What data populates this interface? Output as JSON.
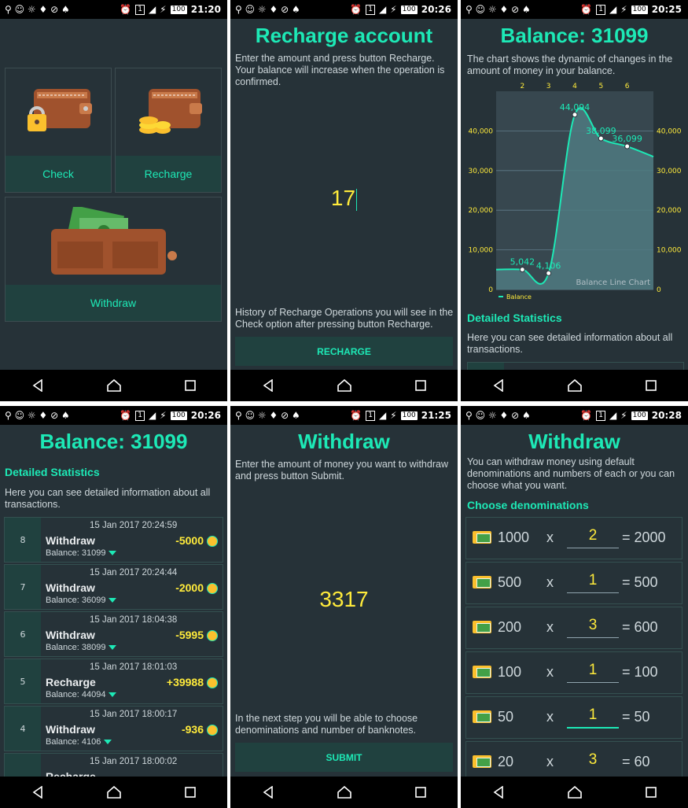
{
  "status": {
    "times": [
      "21:20",
      "20:26",
      "20:25",
      "20:26",
      "21:25",
      "20:28"
    ],
    "sim": "1",
    "battery": "100"
  },
  "home": {
    "check_label": "Check",
    "recharge_label": "Recharge",
    "withdraw_label": "Withdraw"
  },
  "recharge": {
    "title": "Recharge account",
    "instructions": "Enter the amount and press button Recharge. Your balance will increase when the operation is confirmed.",
    "amount_value": "17",
    "history_note": "History of Recharge Operations you will see in the Check option after pressing button Recharge.",
    "button_label": "RECHARGE"
  },
  "balance_chart_screen": {
    "title": "Balance: 31099",
    "description": "The chart shows the dynamic of changes in the amount of money in your balance.",
    "stats_heading": "Detailed Statistics",
    "stats_text": "Here you can see detailed information about all transactions."
  },
  "chart_data": {
    "type": "area",
    "title": "Balance Line Chart",
    "x": [
      1,
      2,
      3,
      4,
      5,
      6,
      7
    ],
    "x_ticks": [
      "2",
      "3",
      "4",
      "5",
      "6"
    ],
    "series": [
      {
        "name": "Balance",
        "values": [
          5042,
          5042,
          4106,
          44094,
          38099,
          36099,
          33500
        ]
      }
    ],
    "data_labels": [
      {
        "x": 2,
        "text": "5,042"
      },
      {
        "x": 3,
        "text": "4,106"
      },
      {
        "x": 4,
        "text": "44,094"
      },
      {
        "x": 5,
        "text": "38,099"
      },
      {
        "x": 6,
        "text": "36,099"
      }
    ],
    "y_ticks": [
      "0",
      "10,000",
      "20,000",
      "30,000",
      "40,000"
    ],
    "ylim": [
      0,
      50000
    ],
    "xlim": [
      1,
      7
    ],
    "grid": true,
    "legend": "bottom-left"
  },
  "stats": {
    "title": "Balance: 31099",
    "heading": "Detailed Statistics",
    "text": "Here you can see detailed information about all transactions.",
    "rows": [
      {
        "num": "8",
        "date": "15 Jan 2017 20:24:59",
        "type": "Withdraw",
        "amount": "-5000",
        "balance": "Balance:  31099"
      },
      {
        "num": "7",
        "date": "15 Jan 2017 20:24:44",
        "type": "Withdraw",
        "amount": "-2000",
        "balance": "Balance:  36099"
      },
      {
        "num": "6",
        "date": "15 Jan 2017 18:04:38",
        "type": "Withdraw",
        "amount": "-5995",
        "balance": "Balance:  38099"
      },
      {
        "num": "5",
        "date": "15 Jan 2017 18:01:03",
        "type": "Recharge",
        "amount": "+39988",
        "balance": "Balance:  44094"
      },
      {
        "num": "4",
        "date": "15 Jan 2017 18:00:17",
        "type": "Withdraw",
        "amount": "-936",
        "balance": "Balance:  4106"
      },
      {
        "num": "",
        "date": "15 Jan 2017 18:00:02",
        "type": "Recharge",
        "amount": "",
        "balance": ""
      }
    ]
  },
  "withdraw": {
    "title": "Withdraw",
    "instructions": "Enter the amount of money you want to withdraw and press button Submit.",
    "amount_value": "3317",
    "note": "In the next step you will be able to choose denominations and number of banknotes.",
    "button_label": "SUBMIT"
  },
  "denominations": {
    "title": "Withdraw",
    "text": "You can withdraw money using default denominations and numbers of each or you can choose what you want.",
    "heading": "Choose denominations",
    "rows": [
      {
        "value": "1000",
        "x": "x",
        "qty": "2",
        "total": "= 2000"
      },
      {
        "value": "500",
        "x": "x",
        "qty": "1",
        "total": "= 500"
      },
      {
        "value": "200",
        "x": "x",
        "qty": "3",
        "total": "= 600"
      },
      {
        "value": "100",
        "x": "x",
        "qty": "1",
        "total": "= 100"
      },
      {
        "value": "50",
        "x": "x",
        "qty": "1",
        "total": "= 50"
      },
      {
        "value": "20",
        "x": "x",
        "qty": "3",
        "total": "= 60"
      }
    ]
  }
}
